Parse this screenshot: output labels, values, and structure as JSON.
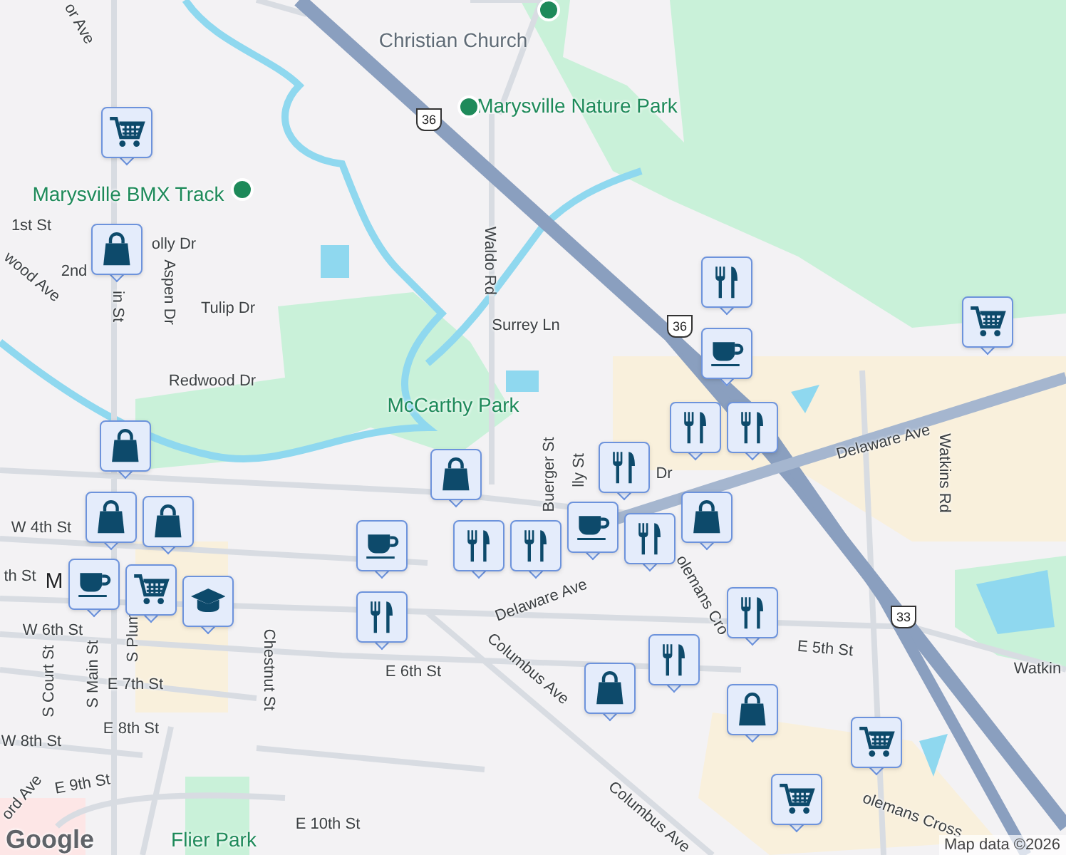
{
  "labels": [
    {
      "text": "Christian Church",
      "kind": "poi"
    },
    {
      "text": "Marysville Nature Park",
      "kind": "park"
    },
    {
      "text": "Marysville BMX Track",
      "kind": "park"
    },
    {
      "text": "McCarthy Park",
      "kind": "park"
    },
    {
      "text": "Flier Park",
      "kind": "park"
    },
    {
      "text": "or Ave",
      "kind": "street"
    },
    {
      "text": "1st St",
      "kind": "street"
    },
    {
      "text": "olly Dr",
      "kind": "street"
    },
    {
      "text": "2nd",
      "kind": "street"
    },
    {
      "text": "wood Ave",
      "kind": "street"
    },
    {
      "text": "in St",
      "kind": "street"
    },
    {
      "text": "Aspen Dr",
      "kind": "street"
    },
    {
      "text": "Tulip Dr",
      "kind": "street"
    },
    {
      "text": "Redwood Dr",
      "kind": "street"
    },
    {
      "text": "Waldo Rd",
      "kind": "street"
    },
    {
      "text": "Surrey Ln",
      "kind": "street"
    },
    {
      "text": "W 4th St",
      "kind": "street"
    },
    {
      "text": "th St",
      "kind": "street"
    },
    {
      "text": "M",
      "kind": "town"
    },
    {
      "text": "W 6th St",
      "kind": "street"
    },
    {
      "text": "S Court St",
      "kind": "street"
    },
    {
      "text": "S Main St",
      "kind": "street"
    },
    {
      "text": "S Plum",
      "kind": "street"
    },
    {
      "text": "E 7th St",
      "kind": "street"
    },
    {
      "text": "E 6th St",
      "kind": "street"
    },
    {
      "text": "Chestnut St",
      "kind": "street"
    },
    {
      "text": "E 8th St",
      "kind": "street"
    },
    {
      "text": "W 8th St",
      "kind": "street"
    },
    {
      "text": "ord Ave",
      "kind": "street"
    },
    {
      "text": "E 9th St",
      "kind": "street"
    },
    {
      "text": "E 10th St",
      "kind": "street"
    },
    {
      "text": "Columbus Ave",
      "kind": "street"
    },
    {
      "text": "Columbus Ave",
      "kind": "street"
    },
    {
      "text": "Delaware Ave",
      "kind": "street"
    },
    {
      "text": "Delaware Ave",
      "kind": "street"
    },
    {
      "text": "Watkins Rd",
      "kind": "street"
    },
    {
      "text": "Watkin",
      "kind": "street"
    },
    {
      "text": "E 5th St",
      "kind": "street"
    },
    {
      "text": "Buerger St",
      "kind": "street"
    },
    {
      "text": "lly St",
      "kind": "street"
    },
    {
      "text": "olemans Cro",
      "kind": "street"
    },
    {
      "text": "olemans Cross",
      "kind": "street"
    },
    {
      "text": "Dr",
      "kind": "street"
    }
  ],
  "shields": [
    "36",
    "36",
    "33"
  ],
  "markers": [
    {
      "kind": "cart"
    },
    {
      "kind": "bag"
    },
    {
      "kind": "food"
    },
    {
      "kind": "cart"
    },
    {
      "kind": "coffee"
    },
    {
      "kind": "food"
    },
    {
      "kind": "food"
    },
    {
      "kind": "bag"
    },
    {
      "kind": "food"
    },
    {
      "kind": "bag"
    },
    {
      "kind": "bag"
    },
    {
      "kind": "food"
    },
    {
      "kind": "food"
    },
    {
      "kind": "coffee"
    },
    {
      "kind": "food"
    },
    {
      "kind": "bag"
    },
    {
      "kind": "coffee"
    },
    {
      "kind": "bag"
    },
    {
      "kind": "coffee"
    },
    {
      "kind": "cart"
    },
    {
      "kind": "school"
    },
    {
      "kind": "food"
    },
    {
      "kind": "food"
    },
    {
      "kind": "food"
    },
    {
      "kind": "bag"
    },
    {
      "kind": "bag"
    },
    {
      "kind": "cart"
    },
    {
      "kind": "cart"
    }
  ],
  "attribution": "Map data ©2026",
  "logo": "Google"
}
